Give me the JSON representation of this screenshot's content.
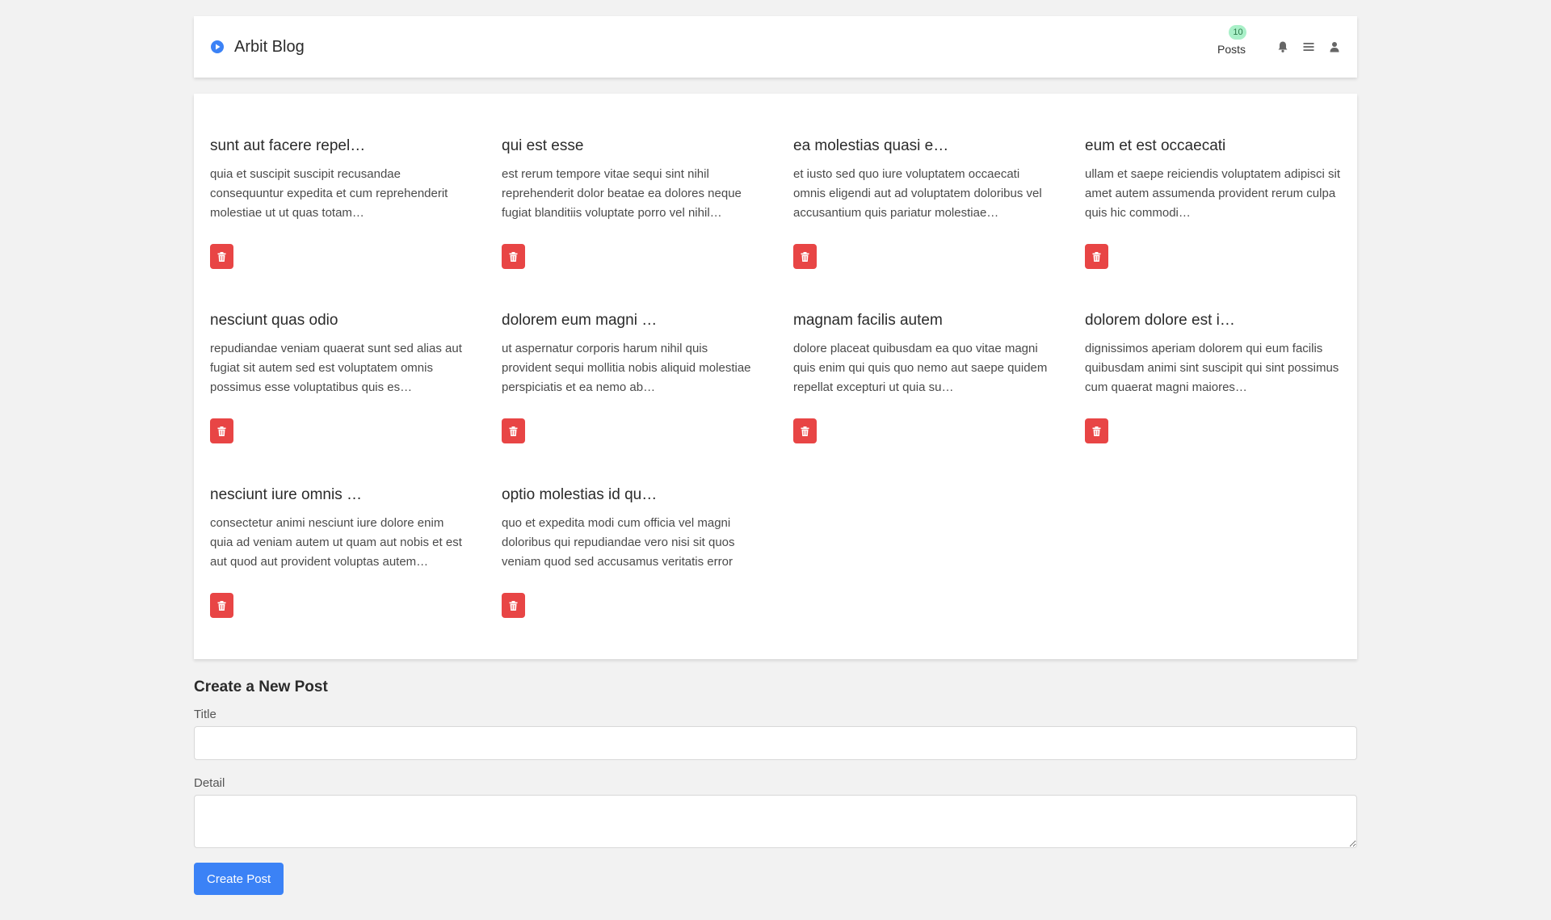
{
  "header": {
    "brand_title": "Arbit Blog",
    "posts_label": "Posts",
    "posts_count": "10",
    "icons": [
      "play-circle-icon",
      "bell-icon",
      "menu-icon",
      "user-icon"
    ],
    "accent_color": "#3b82f6"
  },
  "posts": [
    {
      "title": "sunt aut facere repel…",
      "body": "quia et suscipit suscipit recusandae consequuntur expedita et cum reprehenderit molestiae ut ut quas totam…"
    },
    {
      "title": "qui est esse",
      "body": "est rerum tempore vitae sequi sint nihil reprehenderit dolor beatae ea dolores neque fugiat blanditiis voluptate porro vel nihil…"
    },
    {
      "title": "ea molestias quasi e…",
      "body": "et iusto sed quo iure voluptatem occaecati omnis eligendi aut ad voluptatem doloribus vel accusantium quis pariatur molestiae…"
    },
    {
      "title": "eum et est occaecati",
      "body": "ullam et saepe reiciendis voluptatem adipisci sit amet autem assumenda provident rerum culpa quis hic commodi…"
    },
    {
      "title": "nesciunt quas odio",
      "body": "repudiandae veniam quaerat sunt sed alias aut fugiat sit autem sed est voluptatem omnis possimus esse voluptatibus quis es…"
    },
    {
      "title": "dolorem eum magni …",
      "body": "ut aspernatur corporis harum nihil quis provident sequi mollitia nobis aliquid molestiae perspiciatis et ea nemo ab…"
    },
    {
      "title": "magnam facilis autem",
      "body": "dolore placeat quibusdam ea quo vitae magni quis enim qui quis quo nemo aut saepe quidem repellat excepturi ut quia su…"
    },
    {
      "title": "dolorem dolore est i…",
      "body": "dignissimos aperiam dolorem qui eum facilis quibusdam animi sint suscipit qui sint possimus cum quaerat magni maiores…"
    },
    {
      "title": "nesciunt iure omnis …",
      "body": "consectetur animi nesciunt iure dolore enim quia ad veniam autem ut quam aut nobis et est aut quod aut provident voluptas autem…"
    },
    {
      "title": "optio molestias id qu…",
      "body": "quo et expedita modi cum officia vel magni doloribus qui repudiandae vero nisi sit quos veniam quod sed accusamus veritatis error"
    }
  ],
  "delete_button": {
    "icon": "trash-icon",
    "color": "#e84545"
  },
  "create_form": {
    "heading": "Create a New Post",
    "title_label": "Title",
    "title_value": "",
    "detail_label": "Detail",
    "detail_value": "",
    "submit_label": "Create Post"
  }
}
